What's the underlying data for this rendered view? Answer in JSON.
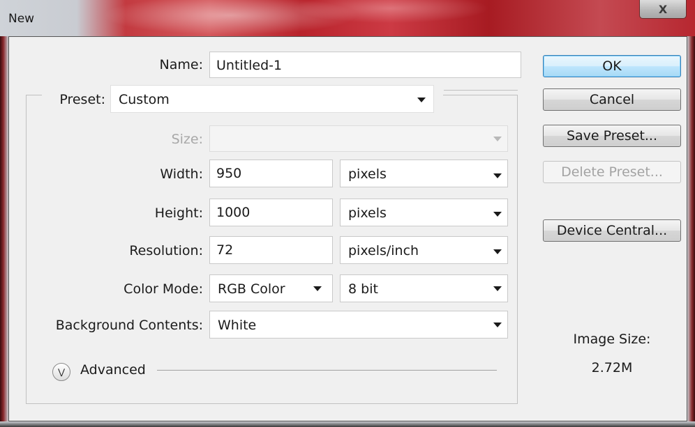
{
  "window": {
    "title": "New",
    "close_glyph": "X"
  },
  "form": {
    "name": {
      "label": "Name:",
      "value": "Untitled-1"
    },
    "preset": {
      "label": "Preset:",
      "value": "Custom"
    },
    "size": {
      "label": "Size:",
      "value": ""
    },
    "width": {
      "label": "Width:",
      "value": "950",
      "unit": "pixels"
    },
    "height": {
      "label": "Height:",
      "value": "1000",
      "unit": "pixels"
    },
    "resolution": {
      "label": "Resolution:",
      "value": "72",
      "unit": "pixels/inch"
    },
    "color_mode": {
      "label": "Color Mode:",
      "value": "RGB Color",
      "depth": "8 bit"
    },
    "background": {
      "label": "Background Contents:",
      "value": "White"
    },
    "advanced": {
      "label": "Advanced",
      "icon": "double-chevron-down-icon"
    }
  },
  "buttons": {
    "ok": "OK",
    "cancel": "Cancel",
    "save_preset": "Save Preset...",
    "delete_preset": "Delete Preset...",
    "device_central": "Device Central..."
  },
  "image_size": {
    "label": "Image Size:",
    "value": "2.72M"
  }
}
